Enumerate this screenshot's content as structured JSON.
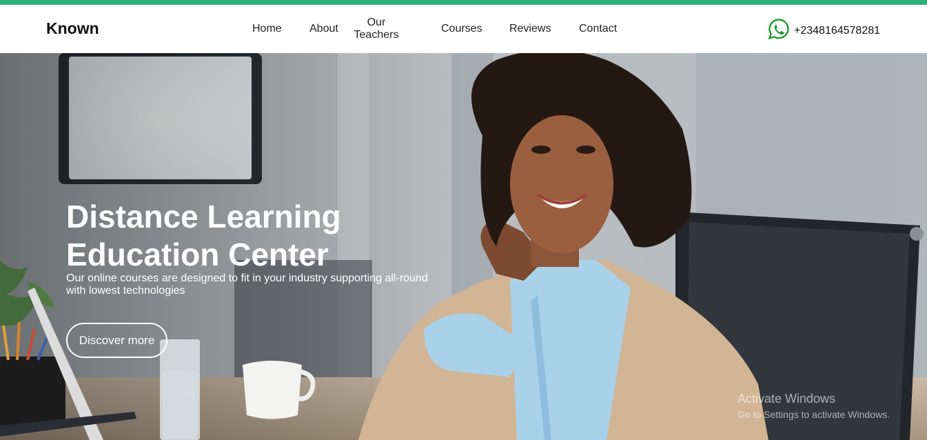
{
  "brand": "Known",
  "nav": {
    "home": "Home",
    "about": "About",
    "teachers_line1": "Our",
    "teachers_line2": "Teachers",
    "courses": "Courses",
    "reviews": "Reviews",
    "contact": "Contact"
  },
  "phone": "+2348164578281",
  "hero": {
    "title_line1": "Distance Learning",
    "title_line2": "Education Center",
    "subtitle_line1": "Our online courses are designed to fit in your industry supporting all-round",
    "subtitle_line2": "with lowest technologies",
    "button": "Discover more"
  },
  "watermark": {
    "title": "Activate Windows",
    "subtitle": "Go to Settings to activate Windows."
  },
  "colors": {
    "accent": "#2fb27a",
    "whatsapp": "#1e9c2e"
  },
  "icons": {
    "phone": "whatsapp-icon"
  }
}
